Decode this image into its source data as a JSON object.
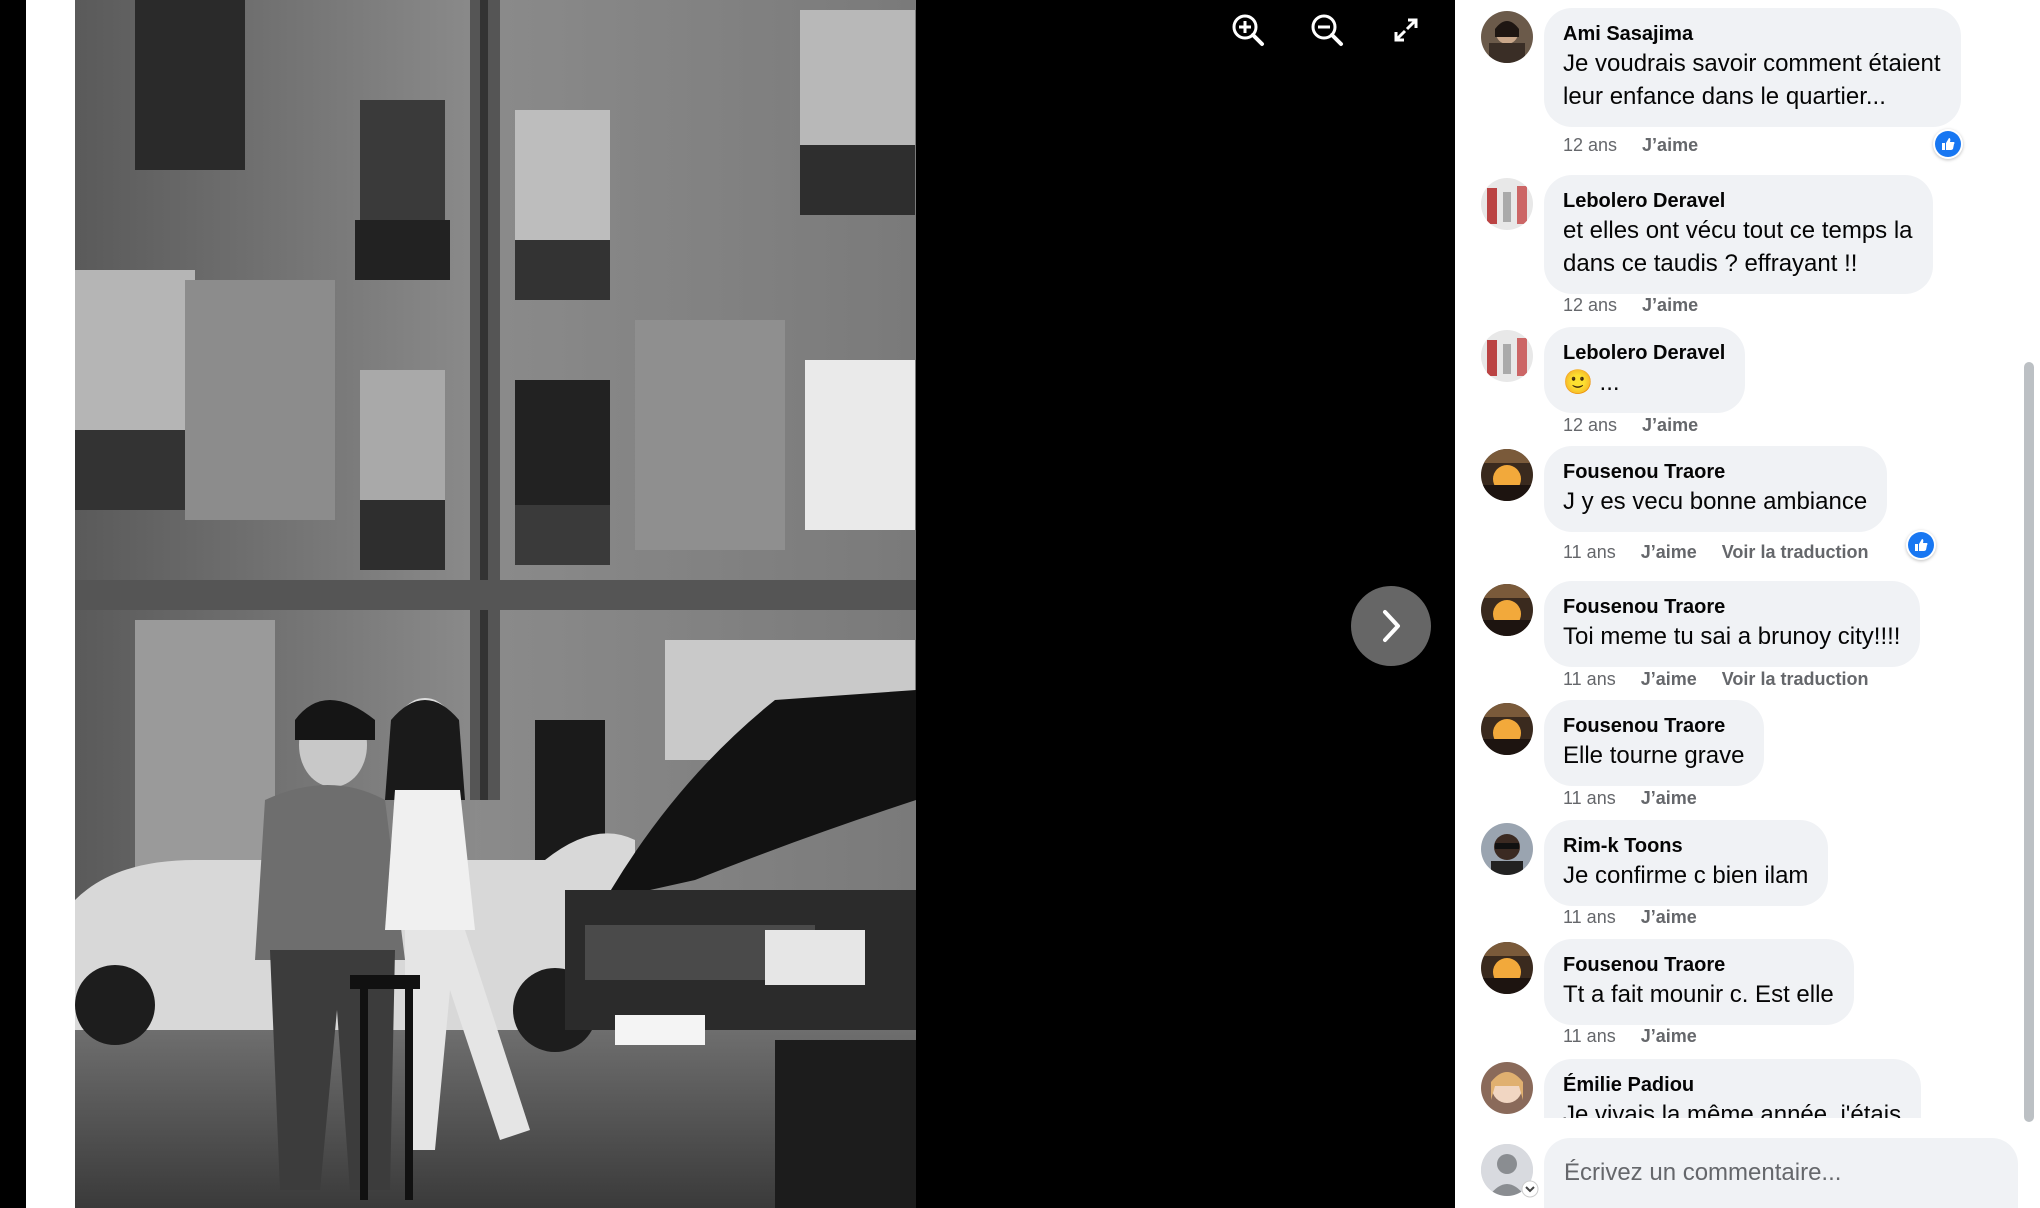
{
  "viewer": {
    "toolbar": {
      "zoom_in_icon": "zoom-in-icon",
      "zoom_out_icon": "zoom-out-icon",
      "fullscreen_icon": "fullscreen-icon"
    },
    "next_icon": "chevron-right-icon"
  },
  "comments": [
    {
      "author": "Ami Sasajima",
      "lines": [
        "Je voudrais savoir comment étaient",
        "leur enfance dans le quartier..."
      ],
      "time": "12 ans",
      "like": "J’aime",
      "reaction": "like"
    },
    {
      "author": "Lebolero Deravel",
      "lines": [
        "et elles ont vécu tout ce temps la",
        "dans ce taudis ? effrayant !!"
      ],
      "time": "12 ans",
      "like": "J’aime"
    },
    {
      "author": "Lebolero Deravel",
      "lines": [
        "🙂 ..."
      ],
      "time": "12 ans",
      "like": "J’aime"
    },
    {
      "author": "Fousenou Traore",
      "lines": [
        "J y es vecu bonne ambiance"
      ],
      "time": "11 ans",
      "like": "J’aime",
      "translate": "Voir la traduction",
      "reaction": "like"
    },
    {
      "author": "Fousenou Traore",
      "lines": [
        "Toi meme tu sai a brunoy city!!!!"
      ],
      "time": "11 ans",
      "like": "J’aime",
      "translate": "Voir la traduction"
    },
    {
      "author": "Fousenou Traore",
      "lines": [
        "Elle tourne grave"
      ],
      "time": "11 ans",
      "like": "J’aime"
    },
    {
      "author": "Rim-k Toons",
      "lines": [
        "Je confirme c bien ilam"
      ],
      "time": "11 ans",
      "like": "J’aime"
    },
    {
      "author": "Fousenou Traore",
      "lines": [
        "Tt a fait mounir c. Est elle"
      ],
      "time": "11 ans",
      "like": "J’aime"
    },
    {
      "author": "Émilie Padiou",
      "lines": [
        "Je vivais la même année, j'étais"
      ]
    }
  ],
  "composer": {
    "placeholder": "Écrivez un commentaire..."
  },
  "colors": {
    "bubble": "#f0f2f5",
    "like_blue": "#1877f2",
    "meta": "#65676b"
  }
}
